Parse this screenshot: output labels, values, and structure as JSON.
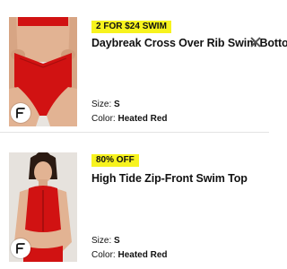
{
  "items": [
    {
      "badge": "2 FOR $24 SWIM",
      "title": "Daybreak Cross Over Rib Swim Bottom",
      "size_label": "Size:",
      "size_value": "S",
      "color_label": "Color:",
      "color_value": "Heated Red",
      "image_icon": "swim-bottom-photo",
      "brand_icon": "brand-f-logo"
    },
    {
      "badge": "80% OFF",
      "title": "High Tide Zip-Front Swim Top",
      "size_label": "Size:",
      "size_value": "S",
      "color_label": "Color:",
      "color_value": "Heated Red",
      "image_icon": "swim-top-photo",
      "brand_icon": "brand-f-logo"
    }
  ],
  "colors": {
    "badge_background": "#f7f31e",
    "swim_red": "#d11212",
    "skin": "#e2b393"
  }
}
